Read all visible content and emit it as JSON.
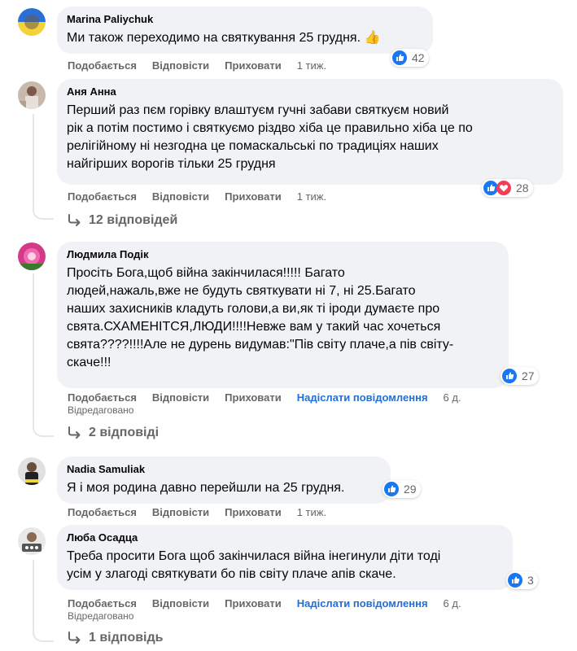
{
  "comments": [
    {
      "author": "Marina Paliychuk",
      "text": "Ми також переходимо на святкування 25 грудня. 👍",
      "reactions": "42",
      "actions": [
        "Подобається",
        "Відповісти",
        "Приховати"
      ],
      "time": "1 тиж."
    },
    {
      "author": "Аня Анна",
      "text": "Перший раз пєм горівку влаштуєм гучні забави святкуєм новий\nрік а потім постимо і святкуємо різдво хіба це правильно хіба це по\nрелігійному ні незгодна це помаскальські по традиціях наших\nнайгірших ворогів тільки 25 грудня",
      "reactions": "28",
      "actions": [
        "Подобається",
        "Відповісти",
        "Приховати"
      ],
      "time": "1 тиж.",
      "replies": "12 відповідей"
    },
    {
      "author": "Людмила Подік",
      "text": "Просіть Бога,щоб війна закінчилася!!!!! Багато\nлюдей,нажаль,вже не будуть святкувати ні 7, ні 25.Багато\nнаших захисників кладуть голови,а ви,як ті іроди думаєте про\nсвята.СХАМЕНІТСЯ,ЛЮДИ!!!!Невже вам у такий час хочеться\nсвята????!!!!Але не дурень видумав:\"Пів світу плаче,а пів світу-\nскаче!!!",
      "reactions": "27",
      "actions": [
        "Подобається",
        "Відповісти",
        "Приховати"
      ],
      "send_message": "Надіслати повідомлення",
      "time": "6 д.",
      "edited": "Відредаговано",
      "replies": "2 відповіді"
    },
    {
      "author": "Nadia Samuliak",
      "text": "Я і моя родина давно перейшли на 25 грудня.",
      "reactions": "29",
      "actions": [
        "Подобається",
        "Відповісти",
        "Приховати"
      ],
      "time": "1 тиж."
    },
    {
      "author": "Люба Осадца",
      "text": "Треба просити Бога щоб закінчилася війна інегинули діти тоді\nусім у злагоді святкувати бо пів світу плаче апів скаче.",
      "reactions": "3",
      "actions": [
        "Подобається",
        "Відповісти",
        "Приховати"
      ],
      "send_message": "Надіслати повідомлення",
      "time": "6 д.",
      "edited": "Відредаговано",
      "replies": "1 відповідь"
    }
  ],
  "colors": {
    "bubble": "#f0f2f5",
    "meta": "#65676b",
    "link": "#216fdb",
    "like": "#1877f2",
    "love": "#f33e58"
  },
  "icons": {
    "like": "like-reaction-icon",
    "love": "love-reaction-icon",
    "reply_arrow": "reply-arrow-icon"
  }
}
